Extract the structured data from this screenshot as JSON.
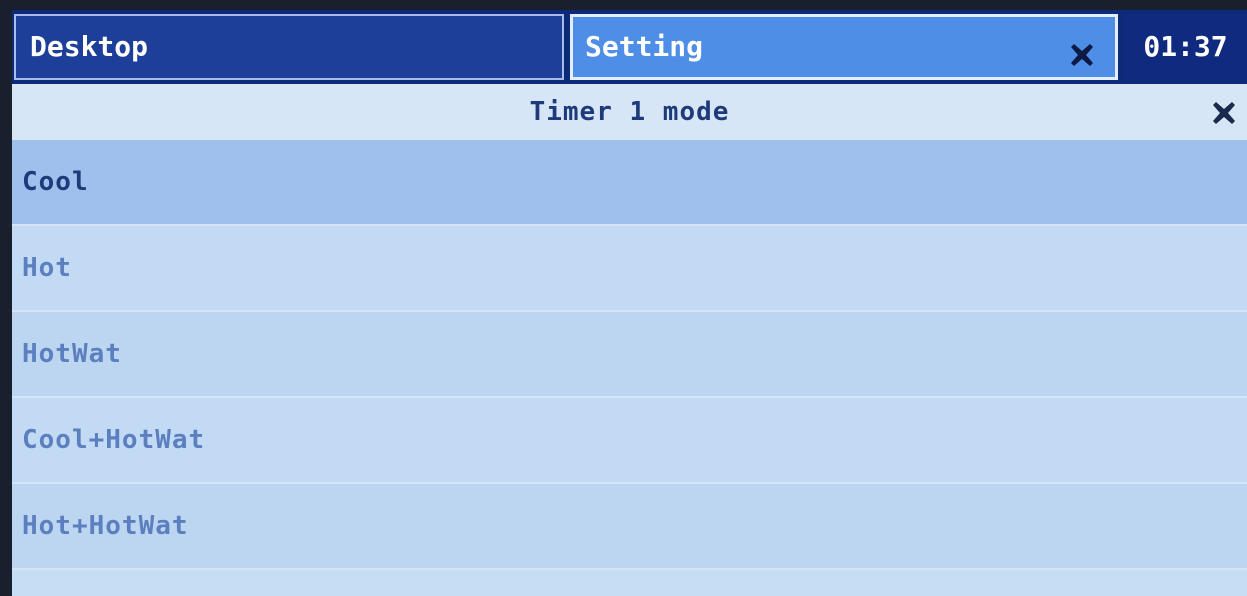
{
  "topbar": {
    "desktop_tab": "Desktop",
    "setting_tab": "Setting",
    "clock": "01:37"
  },
  "dialog": {
    "title": "Timer 1 mode"
  },
  "options": [
    {
      "label": "Cool",
      "selected": true
    },
    {
      "label": "Hot",
      "selected": false
    },
    {
      "label": "HotWat",
      "selected": false
    },
    {
      "label": "Cool+HotWat",
      "selected": false
    },
    {
      "label": "Hot+HotWat",
      "selected": false
    }
  ],
  "colors": {
    "topbar_bg": "#0d2a78",
    "setting_tab_bg": "#4f8ee6",
    "list_bg": "#c2daf3",
    "selected_bg": "#9fc0ec",
    "text_dark": "#1d3a7a",
    "text_light": "#5b7fbf"
  },
  "icons": {
    "tab_close": "close-icon",
    "dialog_close": "close-icon"
  }
}
